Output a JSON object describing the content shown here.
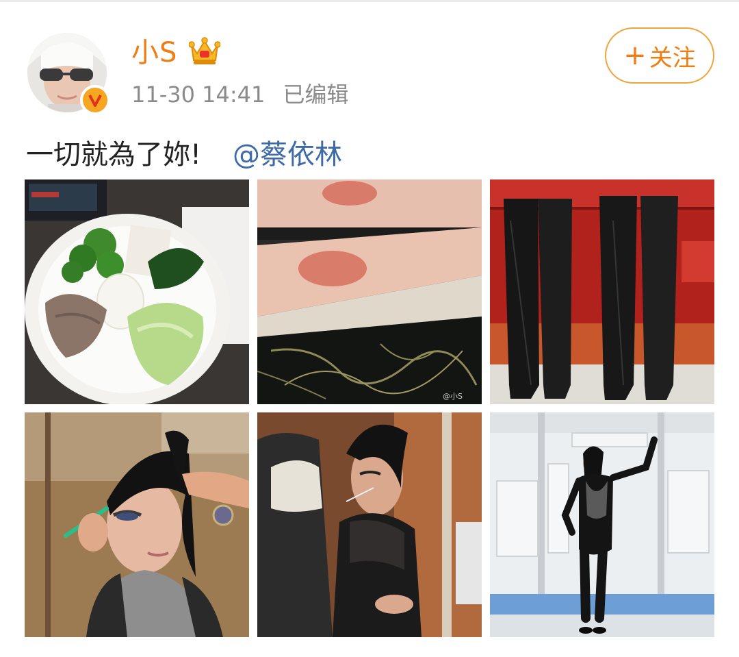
{
  "post": {
    "username": "小S",
    "timestamp": "11-30 14:41",
    "edited_label": "已编辑",
    "follow_plus": "+",
    "follow_label": "关注",
    "text": "一切就為了妳!",
    "mention": "@蔡依林",
    "watermark": "@小S"
  },
  "icons": {
    "verified": "verified-v-icon",
    "crown": "crown-icon"
  },
  "colors": {
    "username": "#ef7d12",
    "follow_border": "#f0a43c",
    "mention": "#3e6aa8",
    "meta": "#8a8a8a",
    "verified_badge": "#f5a623"
  },
  "photos": [
    {
      "subject": "bowl of broccoli, egg, sliced meat and lettuce"
    },
    {
      "subject": "arms with red marks on marble table"
    },
    {
      "subject": "two pairs of black thigh-high boots"
    },
    {
      "subject": "makeup artist applying eyeliner, stylist doing ponytail"
    },
    {
      "subject": "performer in black mesh outfit with headset mic"
    },
    {
      "subject": "performer in black bodysuit and thigh-high boots posing"
    }
  ]
}
